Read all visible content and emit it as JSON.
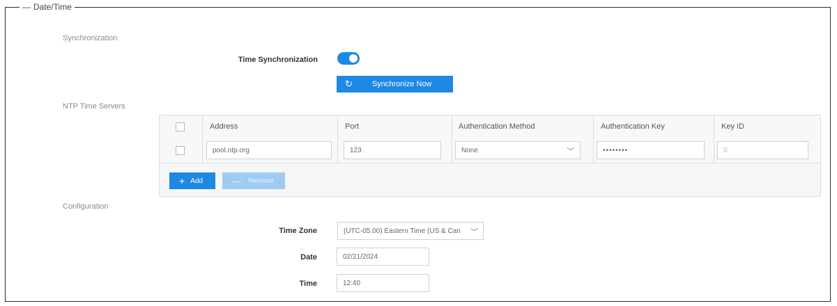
{
  "section": {
    "collapse_symbol": "—",
    "title": "Date/Time"
  },
  "synchronization": {
    "heading": "Synchronization",
    "time_sync_label": "Time Synchronization",
    "time_sync_enabled": true,
    "sync_button_icon": "refresh-icon",
    "sync_button_label": "Synchronize Now"
  },
  "ntp": {
    "heading": "NTP Time Servers",
    "columns": [
      "Address",
      "Port",
      "Authentication Method",
      "Authentication Key",
      "Key ID"
    ],
    "rows": [
      {
        "address": "pool.ntp.org",
        "port": "123",
        "auth_method": "None",
        "auth_key": "••••••••",
        "key_id_placeholder": "0"
      }
    ],
    "add_label": "Add",
    "remove_label": "Remove"
  },
  "configuration": {
    "heading": "Configuration",
    "timezone_label": "Time Zone",
    "timezone_value": "(UTC-05:00) Eastern Time (US & Can",
    "date_label": "Date",
    "date_value": "02/21/2024",
    "time_label": "Time",
    "time_value": "12:40"
  },
  "colors": {
    "accent": "#1e88e5",
    "accent_disabled": "#9ecbf2"
  }
}
